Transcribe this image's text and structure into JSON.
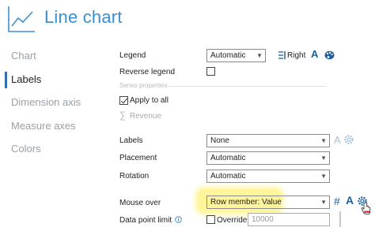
{
  "header": {
    "title": "Line chart",
    "icon": "line-chart-icon"
  },
  "sidebar": {
    "items": [
      {
        "label": "Chart",
        "active": false
      },
      {
        "label": "Labels",
        "active": true
      },
      {
        "label": "Dimension axis",
        "active": false
      },
      {
        "label": "Measure axes",
        "active": false
      },
      {
        "label": "Colors",
        "active": false
      }
    ]
  },
  "legend": {
    "label": "Legend",
    "value": "Automatic",
    "position_label": "Right"
  },
  "reverse_legend": {
    "label": "Reverse legend",
    "checked": false
  },
  "series_properties": {
    "title": "Series properties",
    "apply_to_all": "Apply to all",
    "series_name": "Revenue"
  },
  "labels": {
    "label": "Labels",
    "value": "None"
  },
  "placement": {
    "label": "Placement",
    "value": "Automatic"
  },
  "rotation": {
    "label": "Rotation",
    "value": "Automatic"
  },
  "mouse_over": {
    "label": "Mouse over",
    "value": "Row member: Value"
  },
  "data_point_limit": {
    "label": "Data point limit",
    "override_label": "Override",
    "value": "10000"
  },
  "colors": {
    "accent": "#3b8fd0",
    "highlight": "#fff59a",
    "nav_active_bar": "#2f6fa8",
    "palette_blue": "#1f5f9c"
  }
}
